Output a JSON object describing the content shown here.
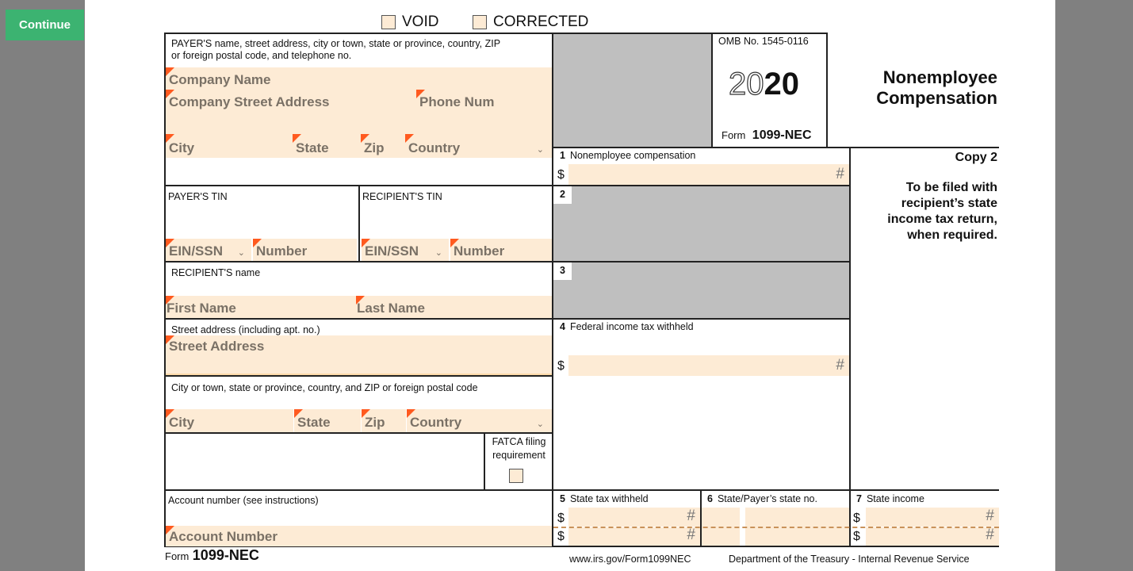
{
  "continue_button": "Continue",
  "top_checkboxes": {
    "void": "VOID",
    "corrected": "CORRECTED"
  },
  "payer": {
    "label_line1": "PAYER'S name, street address, city or town, state or province, country, ZIP",
    "label_line2": "or foreign postal code, and telephone no.",
    "company_name": "Company Name",
    "street_address": "Company Street Address",
    "phone": "Phone Num",
    "city": "City",
    "state": "State",
    "zip": "Zip",
    "country": "Country"
  },
  "omb": {
    "number": "OMB No. 1545-0116",
    "year_outline": "20",
    "year_bold": "20",
    "form_prefix": "Form",
    "form_name": "1099-NEC"
  },
  "title": {
    "line1": "Nonemployee",
    "line2": "Compensation"
  },
  "copy": {
    "label": "Copy 2",
    "line1": "To be filed with",
    "line2": "recipient’s state",
    "line3": "income tax return,",
    "line4": "when required."
  },
  "box1": {
    "num": "1",
    "label": "Nonemployee compensation",
    "dollar": "$",
    "placeholder": "#"
  },
  "box2": {
    "num": "2"
  },
  "box3": {
    "num": "3"
  },
  "box4": {
    "num": "4",
    "label": "Federal income tax withheld",
    "dollar": "$",
    "placeholder": "#"
  },
  "payer_tin": {
    "label": "PAYER'S TIN",
    "type": "EIN/SSN",
    "number": "Number"
  },
  "recipient_tin": {
    "label": "RECIPIENT'S TIN",
    "type": "EIN/SSN",
    "number": "Number"
  },
  "recipient_name": {
    "label": "RECIPIENT'S name",
    "first": "First Name",
    "last": "Last Name"
  },
  "street": {
    "label": "Street address (including apt. no.)",
    "placeholder": "Street Address"
  },
  "city_block": {
    "label": "City or town, state or province, country, and ZIP or foreign postal code",
    "city": "City",
    "state": "State",
    "zip": "Zip",
    "country": "Country"
  },
  "fatca": {
    "line1": "FATCA filing",
    "line2": "requirement"
  },
  "account": {
    "label": "Account number (see instructions)",
    "placeholder": "Account Number"
  },
  "box5": {
    "num": "5",
    "label": "State tax withheld",
    "dollar": "$",
    "placeholder": "#"
  },
  "box6": {
    "num": "6",
    "label": "State/Payer’s state no."
  },
  "box7": {
    "num": "7",
    "label": "State income",
    "dollar": "$",
    "placeholder": "#"
  },
  "footer": {
    "form_prefix": "Form",
    "form_name": "1099-NEC",
    "url": "www.irs.gov/Form1099NEC",
    "department": "Department of the Treasury - Internal Revenue Service"
  }
}
